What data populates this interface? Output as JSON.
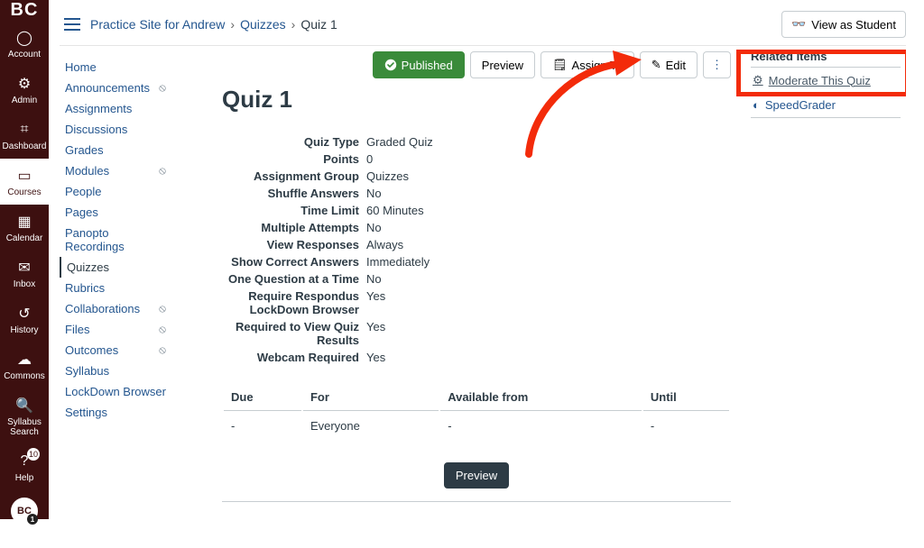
{
  "brand": "BC",
  "globalNav": [
    {
      "id": "account",
      "label": "Account",
      "icon": "◯"
    },
    {
      "id": "admin",
      "label": "Admin",
      "icon": "⚙"
    },
    {
      "id": "dashboard",
      "label": "Dashboard",
      "icon": "⌗"
    },
    {
      "id": "courses",
      "label": "Courses",
      "icon": "▭",
      "active": true
    },
    {
      "id": "calendar",
      "label": "Calendar",
      "icon": "▦"
    },
    {
      "id": "inbox",
      "label": "Inbox",
      "icon": "✉"
    },
    {
      "id": "history",
      "label": "History",
      "icon": "↺"
    },
    {
      "id": "commons",
      "label": "Commons",
      "icon": "☁"
    },
    {
      "id": "syllabus-search",
      "label": "Syllabus Search",
      "icon": "🔍"
    },
    {
      "id": "help",
      "label": "Help",
      "icon": "?",
      "badge": "10"
    }
  ],
  "avatar": {
    "initials": "BC",
    "badge": "1"
  },
  "breadcrumb": {
    "site": "Practice Site for Andrew",
    "section": "Quizzes",
    "page": "Quiz 1"
  },
  "studentView": "View as Student",
  "courseNav": [
    {
      "label": "Home"
    },
    {
      "label": "Announcements",
      "hidden": true
    },
    {
      "label": "Assignments"
    },
    {
      "label": "Discussions"
    },
    {
      "label": "Grades"
    },
    {
      "label": "Modules",
      "hidden": true
    },
    {
      "label": "People"
    },
    {
      "label": "Pages"
    },
    {
      "label": "Panopto Recordings"
    },
    {
      "label": "Quizzes",
      "active": true
    },
    {
      "label": "Rubrics"
    },
    {
      "label": "Collaborations",
      "hidden": true
    },
    {
      "label": "Files",
      "hidden": true
    },
    {
      "label": "Outcomes",
      "hidden": true
    },
    {
      "label": "Syllabus"
    },
    {
      "label": "LockDown Browser"
    },
    {
      "label": "Settings"
    }
  ],
  "toolbar": {
    "published": "Published",
    "preview": "Preview",
    "assign": "Assign To",
    "edit": "Edit"
  },
  "title": "Quiz 1",
  "details": [
    {
      "label": "Quiz Type",
      "value": "Graded Quiz"
    },
    {
      "label": "Points",
      "value": "0"
    },
    {
      "label": "Assignment Group",
      "value": "Quizzes"
    },
    {
      "label": "Shuffle Answers",
      "value": "No"
    },
    {
      "label": "Time Limit",
      "value": "60 Minutes"
    },
    {
      "label": "Multiple Attempts",
      "value": "No"
    },
    {
      "label": "View Responses",
      "value": "Always"
    },
    {
      "label": "Show Correct Answers",
      "value": "Immediately"
    },
    {
      "label": "One Question at a Time",
      "value": "No"
    },
    {
      "label": "Require Respondus LockDown Browser",
      "value": "Yes"
    },
    {
      "label": "Required to View Quiz Results",
      "value": "Yes"
    },
    {
      "label": "Webcam Required",
      "value": "Yes"
    }
  ],
  "dueTable": {
    "headers": {
      "due": "Due",
      "for": "For",
      "from": "Available from",
      "until": "Until"
    },
    "rows": [
      {
        "due": "-",
        "for": "Everyone",
        "from": "-",
        "until": "-"
      }
    ]
  },
  "previewBtn": "Preview",
  "aside": {
    "heading": "Related Items",
    "moderate": "Moderate This Quiz",
    "speedgrader": "SpeedGrader"
  }
}
